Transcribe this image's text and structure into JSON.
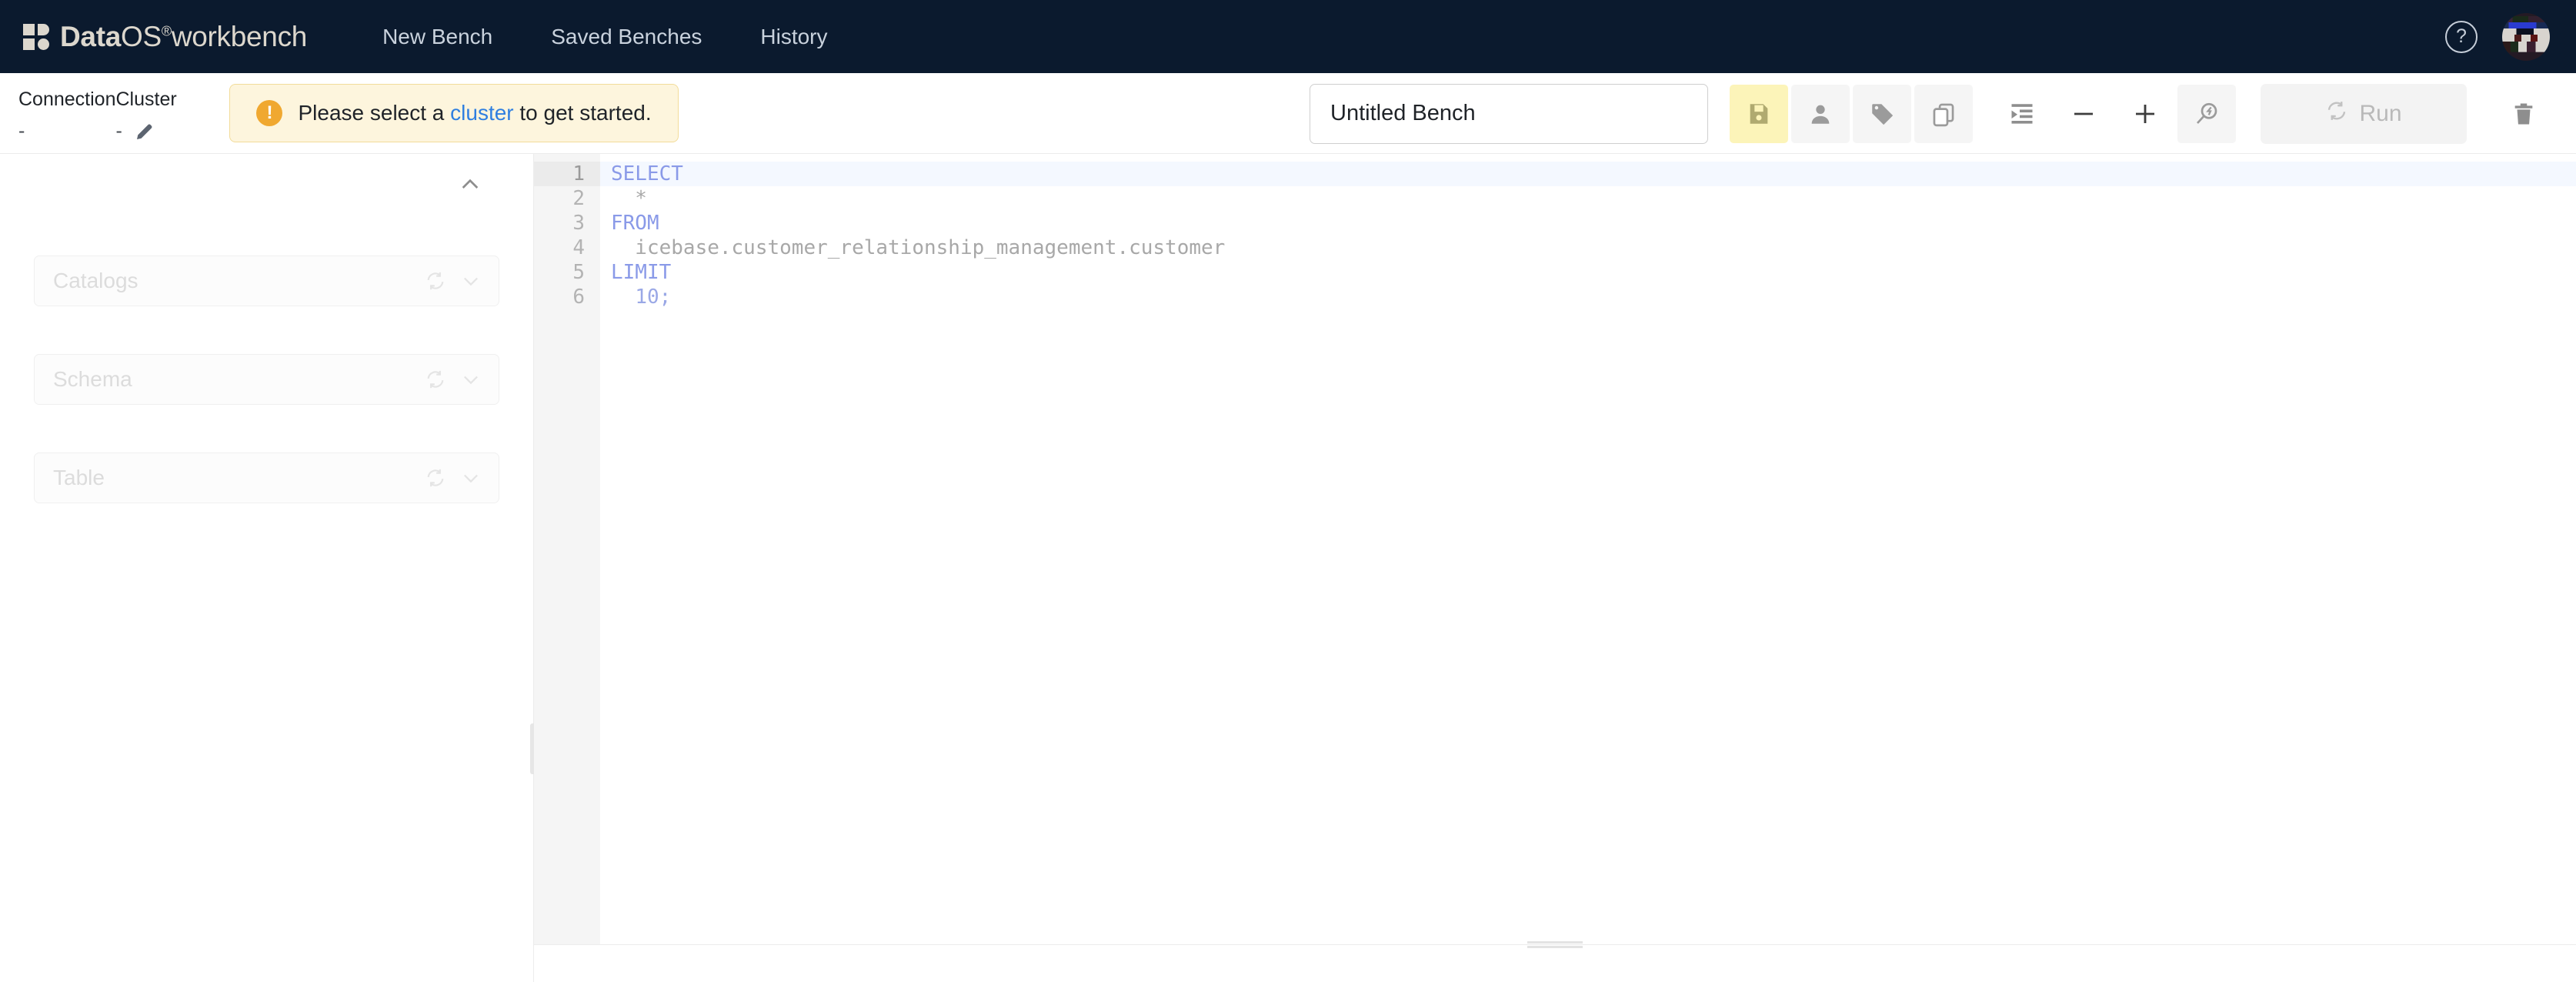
{
  "nav": {
    "brand": {
      "data": "Data",
      "os": "OS",
      "reg": "®",
      "product": "workbench",
      "icon": "dataos-logo-icon"
    },
    "links": [
      {
        "label": "New Bench",
        "name": "nav-new-bench"
      },
      {
        "label": "Saved Benches",
        "name": "nav-saved-benches"
      },
      {
        "label": "History",
        "name": "nav-history"
      }
    ],
    "help_icon": "help-circle-icon",
    "help_glyph": "?",
    "avatar": "user-avatar"
  },
  "toolbar": {
    "connection_label": "Connection",
    "connection_value": "-",
    "cluster_label": "Cluster",
    "cluster_value": "-",
    "edit_cluster_icon": "pencil-icon",
    "alert": {
      "icon": "warning-exclamation-icon",
      "icon_glyph": "!",
      "before": "Please select a ",
      "link": "cluster",
      "after": " to get started."
    },
    "bench_name_value": "Untitled Bench",
    "bench_name_placeholder": "Untitled Bench",
    "buttons": [
      {
        "name": "save-button",
        "icon": "floppy-disk-icon",
        "title": "Save"
      },
      {
        "name": "share-user-button",
        "icon": "person-icon",
        "title": "Share"
      },
      {
        "name": "tag-button",
        "icon": "tag-icon",
        "title": "Tags"
      },
      {
        "name": "copy-button",
        "icon": "copy-icon",
        "title": "Copy"
      },
      {
        "name": "format-button",
        "icon": "indent-format-icon",
        "title": "Format"
      },
      {
        "name": "zoom-out-button",
        "icon": "minus-icon",
        "title": "Zoom out"
      },
      {
        "name": "zoom-in-button",
        "icon": "plus-icon",
        "title": "Zoom in"
      },
      {
        "name": "explain-button",
        "icon": "magnify-lightning-icon",
        "title": "Explain"
      }
    ],
    "run_label": "Run",
    "run_icon": "refresh-icon",
    "delete_icon": "trash-icon"
  },
  "sidebar": {
    "collapse_icon": "chevron-up-icon",
    "selects": [
      {
        "name": "catalogs-select",
        "placeholder": "Catalogs",
        "refresh_icon": "refresh-icon",
        "chevron_icon": "chevron-down-icon"
      },
      {
        "name": "schema-select",
        "placeholder": "Schema",
        "refresh_icon": "refresh-icon",
        "chevron_icon": "chevron-down-icon"
      },
      {
        "name": "table-select",
        "placeholder": "Table",
        "refresh_icon": "refresh-icon",
        "chevron_icon": "chevron-down-icon"
      }
    ],
    "resize_handle": "sidebar-resize-handle"
  },
  "editor": {
    "line_numbers": [
      "1",
      "2",
      "3",
      "4",
      "5",
      "6"
    ],
    "active_line": 1,
    "lines": [
      {
        "kw": "SELECT",
        "txt": "",
        "num": ""
      },
      {
        "kw": "",
        "txt": "  *",
        "num": ""
      },
      {
        "kw": "FROM",
        "txt": "",
        "num": ""
      },
      {
        "kw": "",
        "txt": "  icebase.customer_relationship_management.customer",
        "num": ""
      },
      {
        "kw": "LIMIT",
        "txt": "",
        "num": ""
      },
      {
        "kw": "",
        "txt": "  ",
        "num": "10;"
      }
    ],
    "query_text": "SELECT\n  *\nFROM\n  icebase.customer_relationship_management.customer\nLIMIT\n  10;",
    "resize_handle": "editor-resize-handle"
  },
  "colors": {
    "navbar_bg": "#0b1a2e",
    "brand_fg": "#dcd7cd",
    "alert_bg": "#fdf5dd",
    "alert_border": "#f2dc9a",
    "alert_icon": "#f0a830",
    "link": "#2f7fe0",
    "save_highlight": "#fcf4b9",
    "keyword": "#8a9ae8",
    "code_text": "#a8a8a8",
    "gutter_bg": "#f5f5f5"
  }
}
